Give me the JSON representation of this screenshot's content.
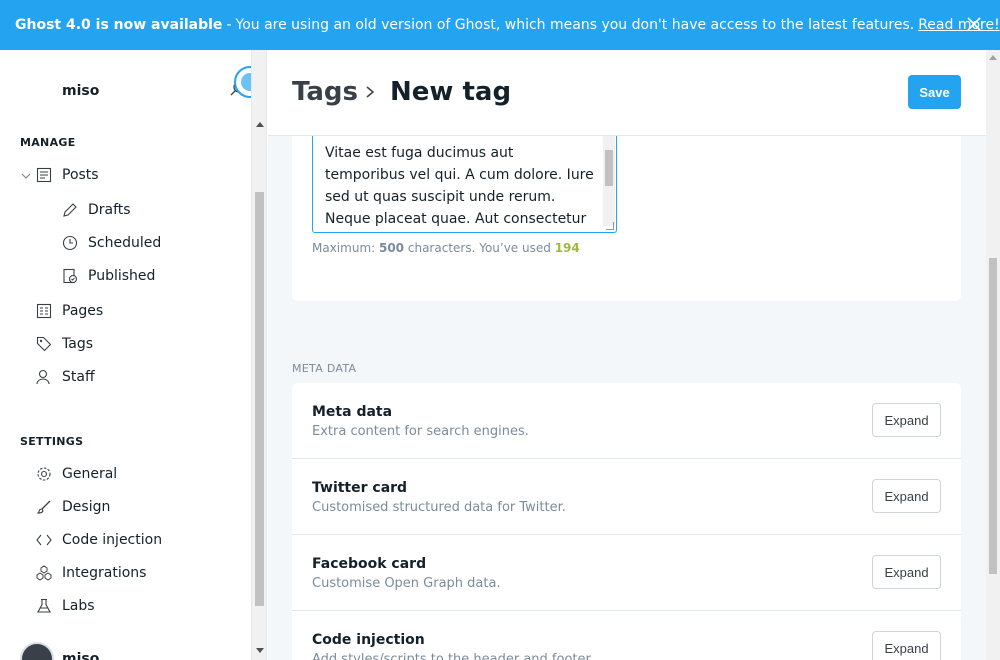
{
  "banner": {
    "title": "Ghost 4.0 is now available",
    "separator": "-",
    "message": "You are using an old version of Ghost, which means you don't have access to the latest features.",
    "link": "Read more!",
    "close_icon": "close-icon"
  },
  "sidebar": {
    "blog_title": "miso",
    "manage_heading": "MANAGE",
    "manage_items": [
      {
        "label": "Posts",
        "icon": "posts-icon"
      },
      {
        "label": "Drafts",
        "icon": "pencil-icon"
      },
      {
        "label": "Scheduled",
        "icon": "clock-icon"
      },
      {
        "label": "Published",
        "icon": "published-icon"
      },
      {
        "label": "Pages",
        "icon": "pages-icon"
      },
      {
        "label": "Tags",
        "icon": "tag-icon"
      },
      {
        "label": "Staff",
        "icon": "staff-icon"
      }
    ],
    "settings_heading": "SETTINGS",
    "settings_items": [
      {
        "label": "General",
        "icon": "gear-icon"
      },
      {
        "label": "Design",
        "icon": "brush-icon"
      },
      {
        "label": "Code injection",
        "icon": "code-icon"
      },
      {
        "label": "Integrations",
        "icon": "integrations-icon"
      },
      {
        "label": "Labs",
        "icon": "flask-icon"
      }
    ],
    "user_name": "miso"
  },
  "header": {
    "breadcrumb": "Tags",
    "title": "New tag",
    "save_label": "Save"
  },
  "description": {
    "text": "Vitae est fuga ducimus aut temporibus vel qui. A cum dolore. Iure sed ut quas suscipit unde rerum. Neque placeat quae. Aut consectetur quibusdam",
    "counter_prefix": "Maximum: ",
    "counter_max": "500",
    "counter_mid": " characters. You’ve used ",
    "counter_used": "194"
  },
  "meta": {
    "section_label": "META DATA",
    "rows": [
      {
        "title": "Meta data",
        "subtitle": "Extra content for search engines.",
        "button": "Expand"
      },
      {
        "title": "Twitter card",
        "subtitle": "Customised structured data for Twitter.",
        "button": "Expand"
      },
      {
        "title": "Facebook card",
        "subtitle": "Customise Open Graph data.",
        "button": "Expand"
      },
      {
        "title": "Code injection",
        "subtitle": "Add styles/scripts to the header and footer.",
        "button": "Expand"
      }
    ]
  },
  "colors": {
    "accent": "#24a4f0",
    "used_count": "#9fba3c"
  }
}
